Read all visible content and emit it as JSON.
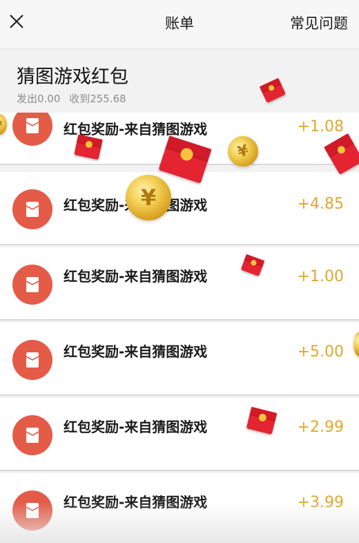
{
  "header": {
    "close_icon": "close-icon",
    "title": "账单",
    "faq_label": "常见问题"
  },
  "summary": {
    "title": "猜图游戏红包",
    "sent": "发出0.00",
    "received": "收到255.68"
  },
  "transactions": [
    {
      "label": "红包奖励-来自猜图游戏",
      "amount": "+1.08",
      "icon": "red-envelope-icon"
    },
    {
      "label": "红包奖励-来自猜图游戏",
      "amount": "+4.85",
      "icon": "red-envelope-icon"
    },
    {
      "label": "红包奖励-来自猜图游戏",
      "amount": "+1.00",
      "icon": "red-envelope-icon"
    },
    {
      "label": "红包奖励-来自猜图游戏",
      "amount": "+5.00",
      "icon": "red-envelope-icon"
    },
    {
      "label": "红包奖励-来自猜图游戏",
      "amount": "+2.99",
      "icon": "red-envelope-icon"
    },
    {
      "label": "红包奖励-来自猜图游戏",
      "amount": "+3.99",
      "icon": "red-envelope-icon"
    }
  ],
  "colors": {
    "amount": "#e0a72b",
    "icon_bg": "#e45b47",
    "packet_red": "#e42431",
    "coin_gold": "#f2cf55"
  }
}
